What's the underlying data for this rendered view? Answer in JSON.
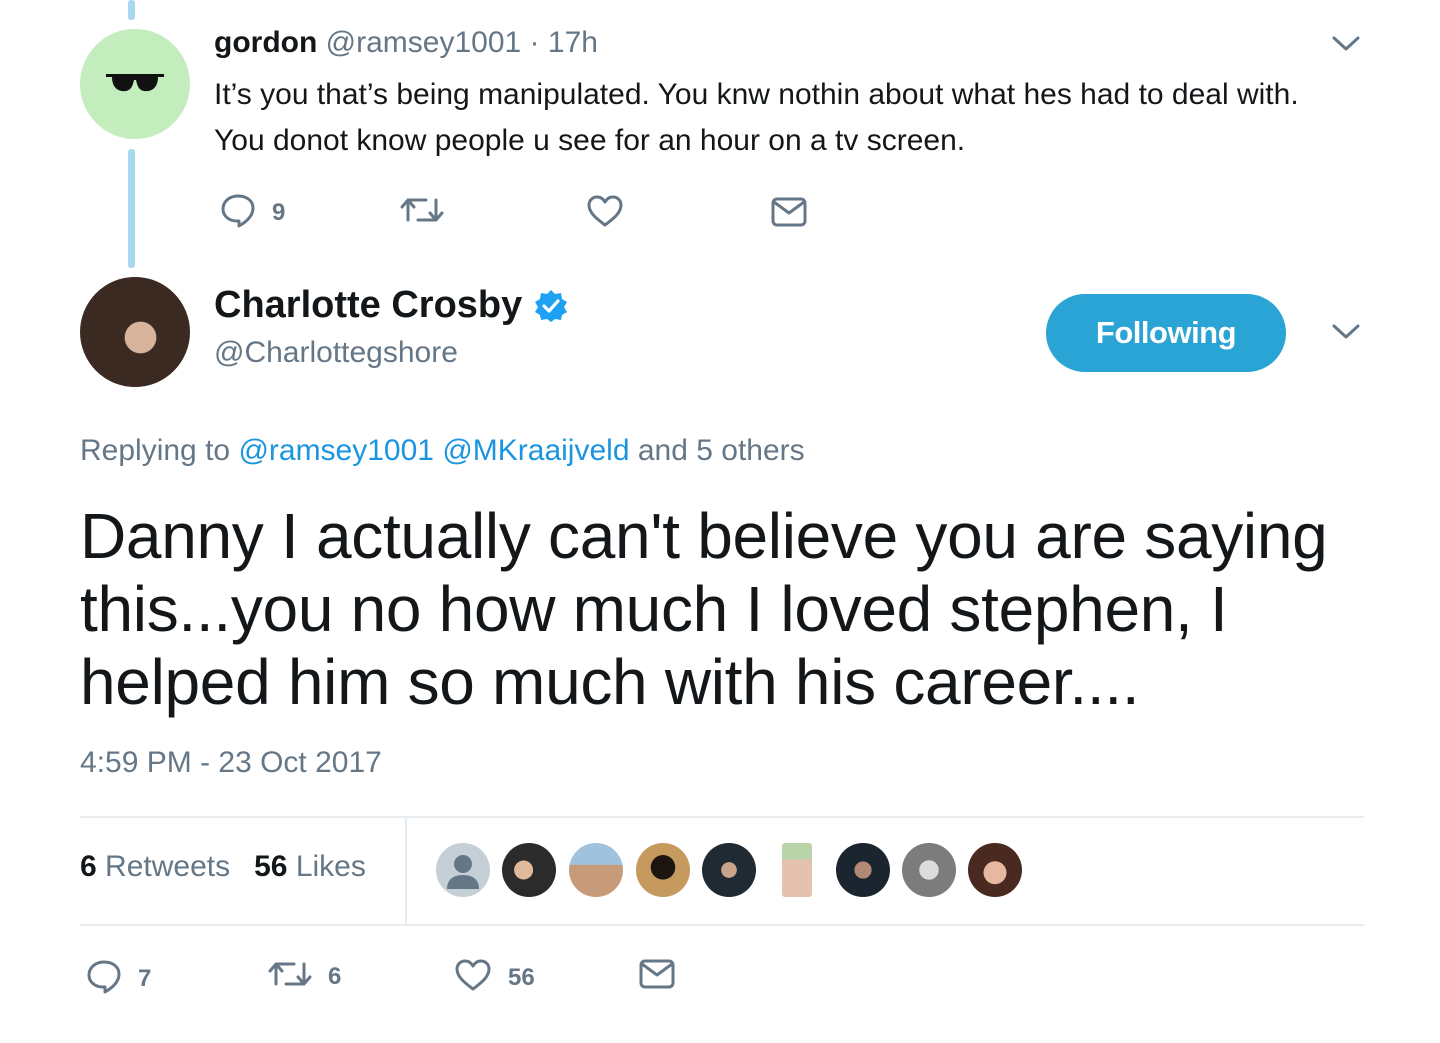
{
  "parent_tweet": {
    "name": "gordon",
    "handle": "@ramsey1001",
    "separator": "·",
    "time": "17h",
    "text": "It’s you that’s being manipulated. You knw nothin about what hes had to deal with. You donot know people u see for an hour on a tv screen.",
    "avatar_icon": "sunglasses-icon",
    "actions": {
      "reply_count": "9",
      "retweet_count": "",
      "like_count": ""
    }
  },
  "main_tweet": {
    "author_name": "Charlotte Crosby",
    "author_handle": "@Charlottegshore",
    "verified_icon": "verified-badge-icon",
    "follow_button_label": "Following",
    "replying_prefix": "Replying to",
    "replying_users": [
      "@ramsey1001",
      "@MKraaijveld"
    ],
    "replying_suffix": "and 5 others",
    "text": "Danny I actually can't believe you are saying this...you no how much I loved stephen, I helped him so much with his career....",
    "timestamp": "4:59 PM - 23 Oct 2017",
    "stats": {
      "retweets_count": "6",
      "retweets_label": "Retweets",
      "likes_count": "56",
      "likes_label": "Likes"
    },
    "likers_count_shown": 9,
    "actions": {
      "reply_count": "7",
      "retweet_count": "6",
      "like_count": "56"
    }
  },
  "colors": {
    "accent_blue": "#1da1f2",
    "follow_button": "#2aa3d5",
    "link_blue": "#1b95e0",
    "muted_text": "#657786",
    "thread_line": "#a8d8ef",
    "parent_avatar_bg": "#c3edbd"
  }
}
